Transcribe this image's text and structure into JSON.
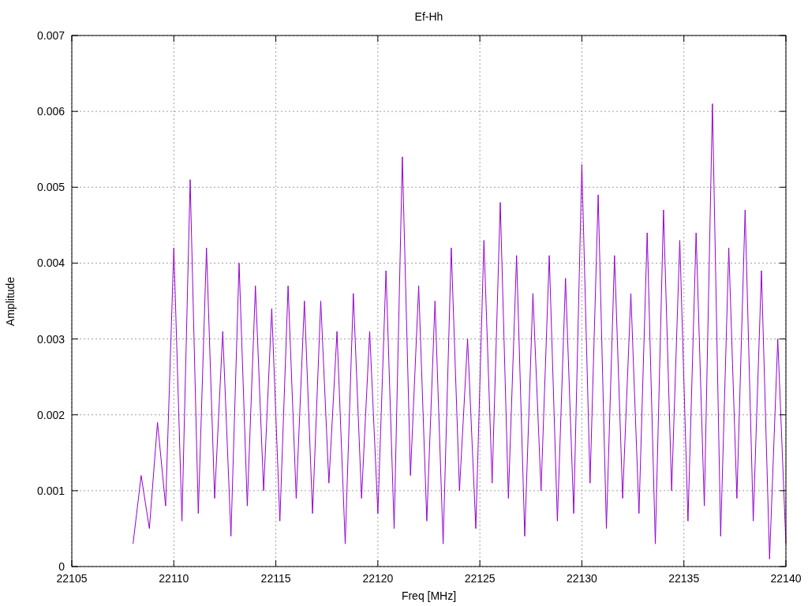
{
  "chart_data": {
    "type": "line",
    "grid": true,
    "title": "Ef-Hh",
    "xlabel": "Freq [MHz]",
    "ylabel": "Amplitude",
    "xlim": [
      22105,
      22140
    ],
    "ylim": [
      0,
      0.007
    ],
    "xticks": [
      22105,
      22110,
      22115,
      22120,
      22125,
      22130,
      22135,
      22140
    ],
    "yticks": [
      {
        "value": 0,
        "label": "0"
      },
      {
        "value": 0.001,
        "label": "0.001"
      },
      {
        "value": 0.002,
        "label": "0.002"
      },
      {
        "value": 0.003,
        "label": "0.003"
      },
      {
        "value": 0.004,
        "label": "0.004"
      },
      {
        "value": 0.005,
        "label": "0.005"
      },
      {
        "value": 0.006,
        "label": "0.006"
      },
      {
        "value": 0.007,
        "label": "0.007"
      }
    ],
    "x": [
      22108.0,
      22108.4,
      22108.8,
      22109.2,
      22109.6,
      22110.0,
      22110.4,
      22110.8,
      22111.2,
      22111.6,
      22112.0,
      22112.4,
      22112.8,
      22113.2,
      22113.6,
      22114.0,
      22114.4,
      22114.8,
      22115.2,
      22115.6,
      22116.0,
      22116.4,
      22116.8,
      22117.2,
      22117.6,
      22118.0,
      22118.4,
      22118.8,
      22119.2,
      22119.6,
      22120.0,
      22120.4,
      22120.8,
      22121.2,
      22121.6,
      22122.0,
      22122.4,
      22122.8,
      22123.2,
      22123.6,
      22124.0,
      22124.4,
      22124.8,
      22125.2,
      22125.6,
      22126.0,
      22126.4,
      22126.8,
      22127.2,
      22127.6,
      22128.0,
      22128.4,
      22128.8,
      22129.2,
      22129.6,
      22130.0,
      22130.4,
      22130.8,
      22131.2,
      22131.6,
      22132.0,
      22132.4,
      22132.8,
      22133.2,
      22133.6,
      22134.0,
      22134.4,
      22134.8,
      22135.2,
      22135.6,
      22136.0,
      22136.4,
      22136.8,
      22137.2,
      22137.6,
      22138.0,
      22138.4,
      22138.8,
      22139.2,
      22139.6,
      22140.0
    ],
    "series": [
      {
        "color": "#9400d3",
        "values": [
          0.0003,
          0.0012,
          0.0005,
          0.0019,
          0.0008,
          0.0042,
          0.0006,
          0.0051,
          0.0007,
          0.0042,
          0.0009,
          0.0031,
          0.0004,
          0.004,
          0.0008,
          0.0037,
          0.001,
          0.0034,
          0.0006,
          0.0037,
          0.0009,
          0.0035,
          0.0007,
          0.0035,
          0.0011,
          0.0031,
          0.0003,
          0.0036,
          0.0009,
          0.0031,
          0.0007,
          0.0039,
          0.0005,
          0.0054,
          0.0012,
          0.0037,
          0.0006,
          0.0035,
          0.0003,
          0.0042,
          0.001,
          0.003,
          0.0005,
          0.0043,
          0.0011,
          0.0048,
          0.0009,
          0.0041,
          0.0004,
          0.0036,
          0.001,
          0.0041,
          0.0006,
          0.0038,
          0.0007,
          0.0053,
          0.0011,
          0.0049,
          0.0005,
          0.0041,
          0.0009,
          0.0036,
          0.0007,
          0.0044,
          0.0003,
          0.0047,
          0.001,
          0.0043,
          0.0006,
          0.0044,
          0.0008,
          0.0061,
          0.0004,
          0.0042,
          0.0009,
          0.0047,
          0.0006,
          0.0039,
          0.0001,
          0.003,
          0.0003
        ]
      }
    ]
  }
}
